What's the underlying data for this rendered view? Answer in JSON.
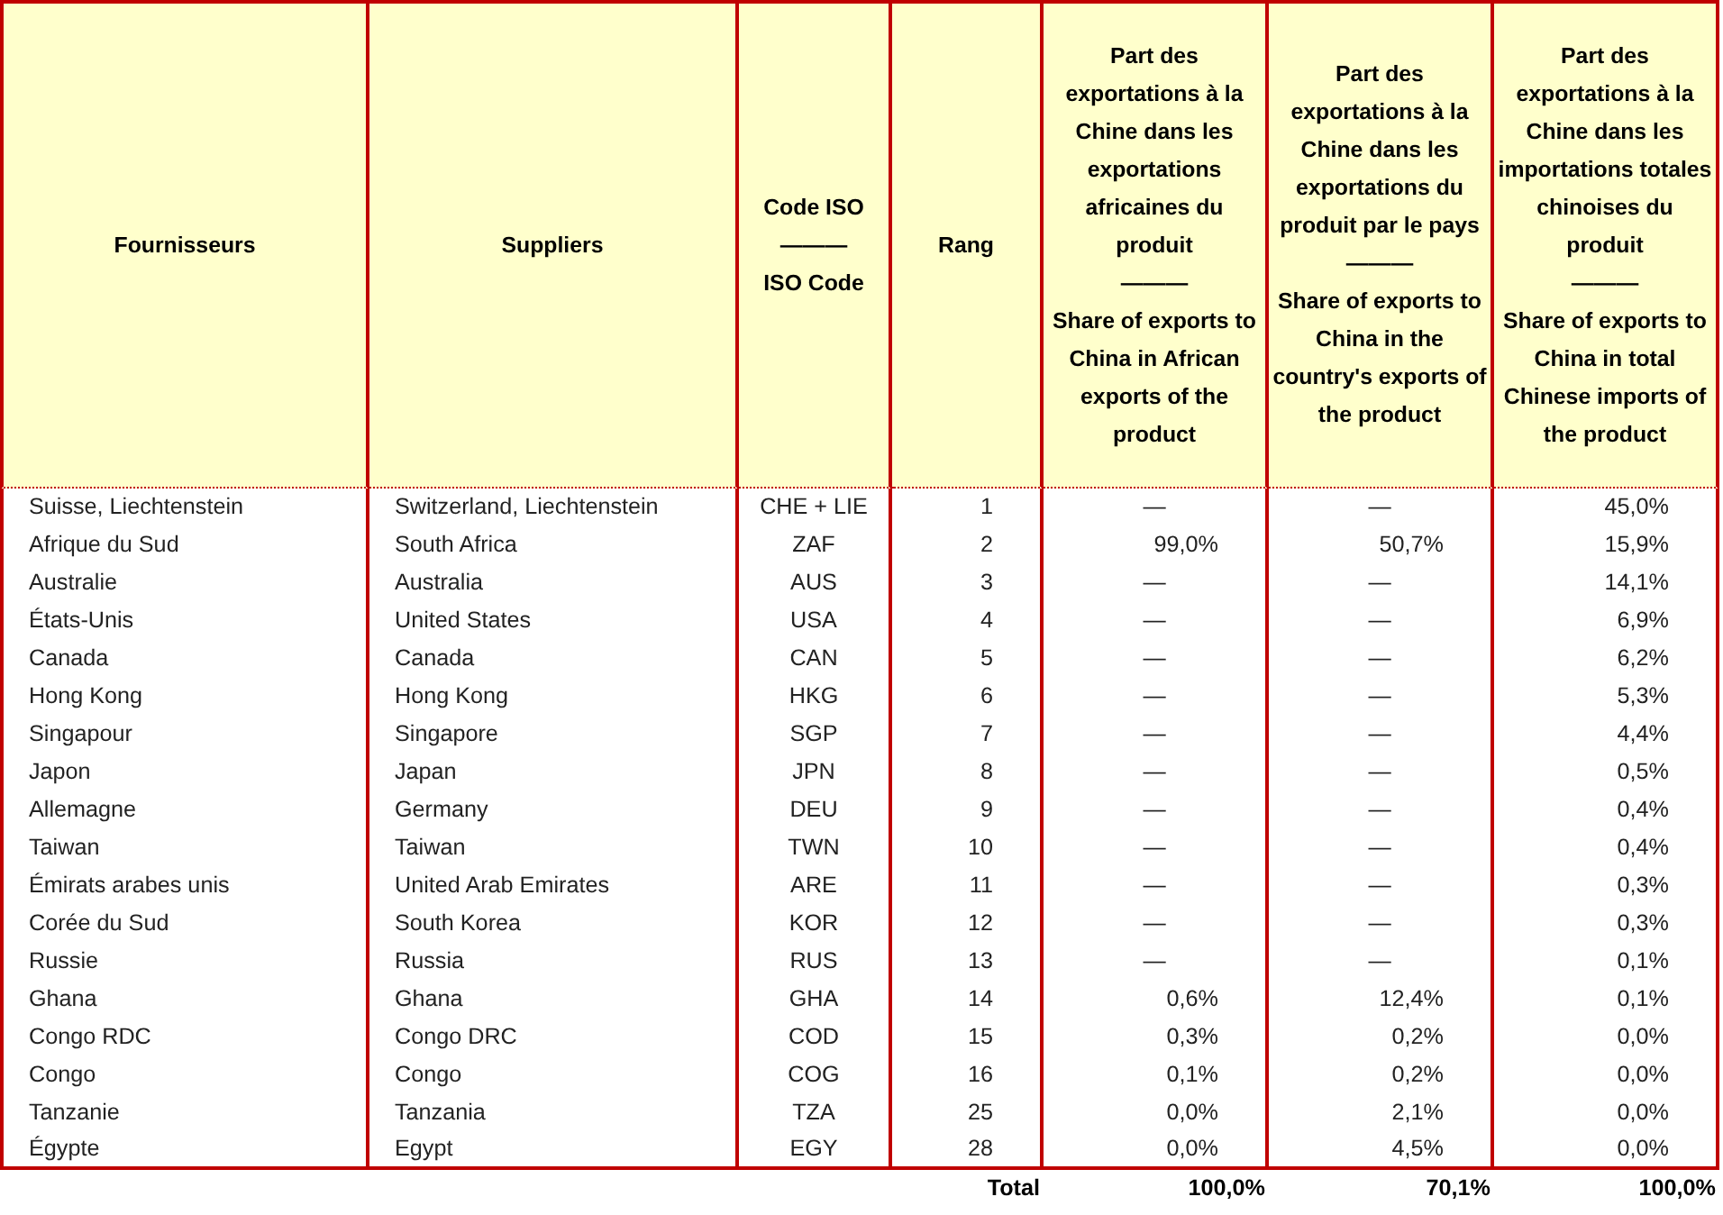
{
  "table": {
    "columns": [
      {
        "label": "Fournisseurs"
      },
      {
        "label": "Suppliers"
      },
      {
        "label": "Code ISO",
        "separator": "———",
        "label_en": "ISO Code"
      },
      {
        "label": "Rang"
      },
      {
        "label": "Part des exportations à la Chine dans les exportations africaines du produit",
        "separator": "———",
        "label_en": "Share of exports to China in African exports of the product"
      },
      {
        "label": "Part des exportations à la Chine dans les exportations du produit par le pays",
        "separator": "———",
        "label_en": "Share of exports to China in the country's exports of the product"
      },
      {
        "label": "Part des exportations à la Chine dans les importations totales chinoises du produit",
        "separator": "———",
        "label_en": "Share of exports to China in total Chinese imports of the product"
      }
    ],
    "rows": [
      [
        "Suisse, Liechtenstein",
        "Switzerland, Liechtenstein",
        "CHE + LIE",
        "1",
        "—",
        "—",
        "45,0%"
      ],
      [
        "Afrique du Sud",
        "South Africa",
        "ZAF",
        "2",
        "99,0%",
        "50,7%",
        "15,9%"
      ],
      [
        "Australie",
        "Australia",
        "AUS",
        "3",
        "—",
        "—",
        "14,1%"
      ],
      [
        "États-Unis",
        "United States",
        "USA",
        "4",
        "—",
        "—",
        "6,9%"
      ],
      [
        "Canada",
        "Canada",
        "CAN",
        "5",
        "—",
        "—",
        "6,2%"
      ],
      [
        "Hong Kong",
        "Hong Kong",
        "HKG",
        "6",
        "—",
        "—",
        "5,3%"
      ],
      [
        "Singapour",
        "Singapore",
        "SGP",
        "7",
        "—",
        "—",
        "4,4%"
      ],
      [
        "Japon",
        "Japan",
        "JPN",
        "8",
        "—",
        "—",
        "0,5%"
      ],
      [
        "Allemagne",
        "Germany",
        "DEU",
        "9",
        "—",
        "—",
        "0,4%"
      ],
      [
        "Taiwan",
        "Taiwan",
        "TWN",
        "10",
        "—",
        "—",
        "0,4%"
      ],
      [
        "Émirats arabes unis",
        "United Arab Emirates",
        "ARE",
        "11",
        "—",
        "—",
        "0,3%"
      ],
      [
        "Corée du Sud",
        "South Korea",
        "KOR",
        "12",
        "—",
        "—",
        "0,3%"
      ],
      [
        "Russie",
        "Russia",
        "RUS",
        "13",
        "—",
        "—",
        "0,1%"
      ],
      [
        "Ghana",
        "Ghana",
        "GHA",
        "14",
        "0,6%",
        "12,4%",
        "0,1%"
      ],
      [
        "Congo RDC",
        "Congo DRC",
        "COD",
        "15",
        "0,3%",
        "0,2%",
        "0,0%"
      ],
      [
        "Congo",
        "Congo",
        "COG",
        "16",
        "0,1%",
        "0,2%",
        "0,0%"
      ],
      [
        "Tanzanie",
        "Tanzania",
        "TZA",
        "25",
        "0,0%",
        "2,1%",
        "0,0%"
      ],
      [
        "Égypte",
        "Egypt",
        "EGY",
        "28",
        "0,0%",
        "4,5%",
        "0,0%"
      ]
    ],
    "total": {
      "label": "Total",
      "values": [
        "100,0%",
        "70,1%",
        "100,0%"
      ]
    }
  }
}
